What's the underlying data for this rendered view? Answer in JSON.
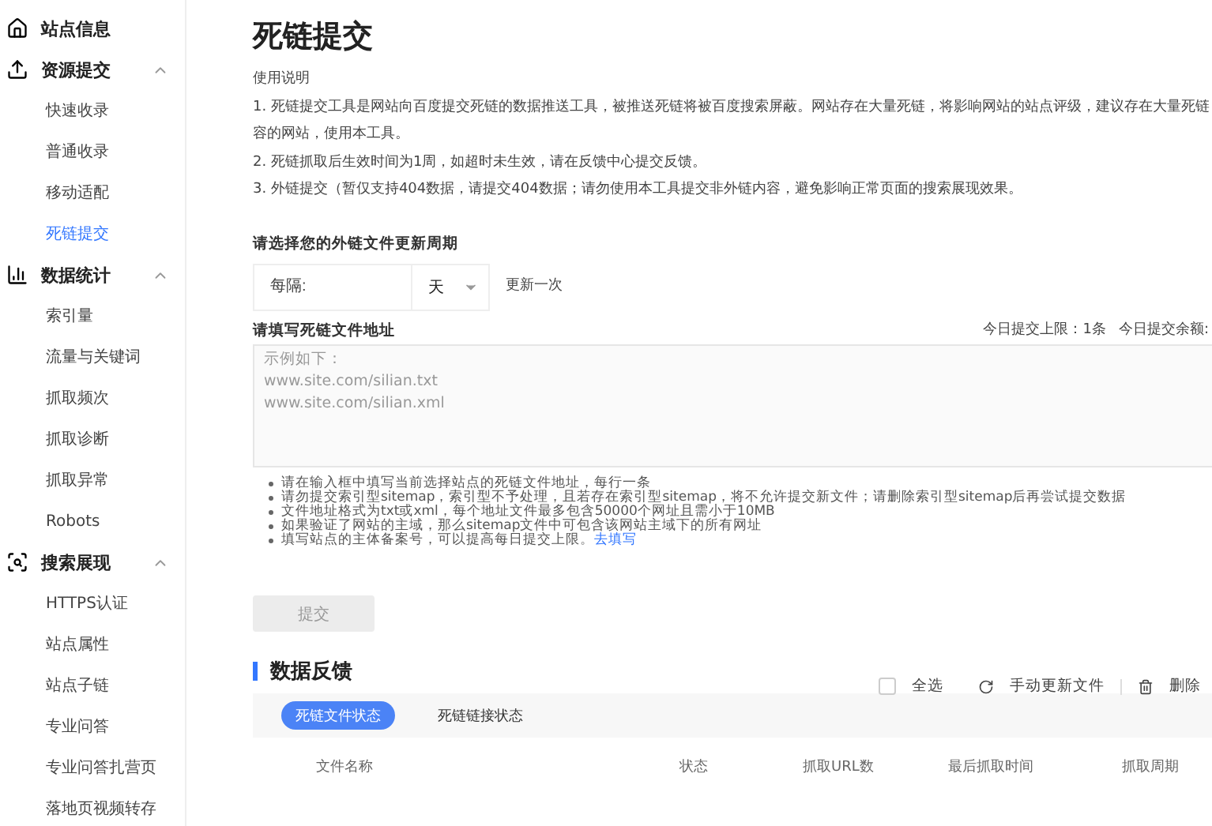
{
  "sidebar": {
    "groups": [
      {
        "label": "站点信息"
      },
      {
        "label": "资源提交",
        "expanded": true,
        "items": [
          {
            "label": "快速收录",
            "selected": false
          },
          {
            "label": "普通收录",
            "selected": false
          },
          {
            "label": "移动适配",
            "selected": false
          },
          {
            "label": "死链提交",
            "selected": true
          }
        ]
      },
      {
        "label": "数据统计",
        "expanded": true,
        "items": [
          {
            "label": "索引量",
            "selected": false
          },
          {
            "label": "流量与关键词",
            "selected": false
          },
          {
            "label": "抓取频次",
            "selected": false
          },
          {
            "label": "抓取诊断",
            "selected": false
          },
          {
            "label": "抓取异常",
            "selected": false
          },
          {
            "label": "Robots",
            "selected": false
          }
        ]
      },
      {
        "label": "搜索展现",
        "expanded": true,
        "items": [
          {
            "label": "HTTPS认证",
            "selected": false
          },
          {
            "label": "站点属性",
            "selected": false
          },
          {
            "label": "站点子链",
            "selected": false
          },
          {
            "label": "专业问答",
            "selected": false
          },
          {
            "label": "专业问答扎营页",
            "selected": false
          },
          {
            "label": "落地页视频转存",
            "selected": false
          }
        ]
      }
    ]
  },
  "page": {
    "title": "死链提交",
    "usage_heading": "使用说明",
    "usage": [
      {
        "text": "1. 死链提交工具是网站向百度提交死链的数据推送工具，被推送死链将被百度搜索屏蔽。网站存在大量死链，将影响网站的站点评级，建议存在大量死链",
        "continuation": "容的网站，使用本工具。"
      },
      {
        "text": "2. 死链抓取后生效时间为1周，如超时未生效，请在反馈中心提交反馈。"
      },
      {
        "text": "3. 外链提交（暂仅支持404数据，请提交404数据；请勿使用本工具提交非外链内容，避免影响正常页面的搜索展现效果。"
      }
    ]
  },
  "period": {
    "label": "请选择您的外链文件更新周期",
    "every_placeholder": "每隔:",
    "unit": "天",
    "suffix": "更新一次"
  },
  "file": {
    "label": "请填写死链文件地址",
    "quota": "今日提交上限：1条",
    "remaining": "今日提交余额:",
    "placeholder": "示例如下：\nwww.site.com/silian.txt\nwww.site.com/silian.xml"
  },
  "notes": [
    {
      "text": "请在输入框中填写当前选择站点的死链文件地址，每行一条"
    },
    {
      "text": "请勿提交索引型sitemap，索引型不予处理，且若存在索引型sitemap，将不允许提交新文件；请删除索引型sitemap后再尝试提交数据"
    },
    {
      "text": "文件地址格式为txt或xml，每个地址文件最多包含50000个网址且需小于10MB"
    },
    {
      "text": "如果验证了网站的主域，那么sitemap文件中可包含该网站主域下的所有网址"
    },
    {
      "text": "填写站点的主体备案号，可以提高每日提交上限。",
      "link": "去填写"
    }
  ],
  "submit": {
    "label": "提交",
    "disabled": true
  },
  "feedback": {
    "title": "数据反馈",
    "select_all": {
      "label": "全选",
      "checked": false
    },
    "refresh": "手动更新文件",
    "delete": "删除",
    "tabs": [
      {
        "label": "死链文件状态",
        "selected": true
      },
      {
        "label": "死链链接状态",
        "selected": false
      }
    ],
    "columns": [
      "文件名称",
      "状态",
      "抓取URL数",
      "最后抓取时间",
      "抓取周期"
    ]
  }
}
